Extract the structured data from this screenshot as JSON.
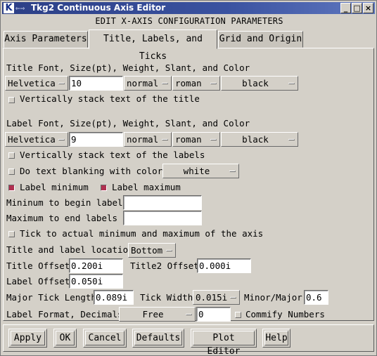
{
  "window": {
    "icon_letter": "K",
    "title": "Tkg2 Continuous Axis Editor",
    "minimize_glyph": "_",
    "maximize_glyph": "□",
    "close_glyph": "×"
  },
  "header": "EDIT X-AXIS CONFIGURATION PARAMETERS",
  "tabs": [
    {
      "label": "Axis Parameters",
      "active": false
    },
    {
      "label": "Title, Labels, and Ticks",
      "active": true
    },
    {
      "label": "Grid and Origin",
      "active": false
    }
  ],
  "title_font": {
    "heading": "Title Font, Size(pt), Weight, Slant, and Color",
    "family": "Helvetica",
    "size": "10",
    "weight": "normal",
    "slant": "roman",
    "color": "black",
    "stack_label": "Vertically stack text of the title",
    "stack_checked": false
  },
  "label_font": {
    "heading": "Label Font, Size(pt), Weight, Slant, and Color",
    "family": "Helvetica",
    "size": "9",
    "weight": "normal",
    "slant": "roman",
    "color": "black",
    "stack_label": "Vertically stack text of the labels",
    "stack_checked": false
  },
  "blanking": {
    "label": "Do text blanking with color:",
    "checked": false,
    "color": "white"
  },
  "label_min": {
    "label": "Label minimum",
    "checked": true
  },
  "label_max": {
    "label": "Label maximum",
    "checked": true
  },
  "min_begin": {
    "label": "Mininum to begin labels",
    "value": ""
  },
  "max_end": {
    "label": "Maximum to end labels",
    "value": ""
  },
  "tick_actual": {
    "label": "Tick to actual minimum and maximum of the axis",
    "checked": false
  },
  "location": {
    "label": "Title and label location",
    "value": "Bottom"
  },
  "title_offset": {
    "label": "Title Offset",
    "value": "0.200i"
  },
  "title2_offset": {
    "label": "Title2 Offset",
    "value": "0.000i"
  },
  "label_offset": {
    "label": "Label Offset",
    "value": "0.050i"
  },
  "major_tick": {
    "label": "Major Tick Length",
    "value": "0.089i"
  },
  "tick_width": {
    "label": "Tick Width",
    "value": "0.015i"
  },
  "minor_major": {
    "label": "Minor/Major",
    "value": "0.6"
  },
  "label_format": {
    "label": "Label Format, Decimals",
    "format": "Free",
    "decimals": "0"
  },
  "commify": {
    "label": "Commify Numbers",
    "checked": false
  },
  "buttons": {
    "apply": "Apply",
    "ok": "OK",
    "cancel": "Cancel",
    "defaults": "Defaults",
    "plot_editor": "Plot Editor",
    "help": "Help"
  }
}
